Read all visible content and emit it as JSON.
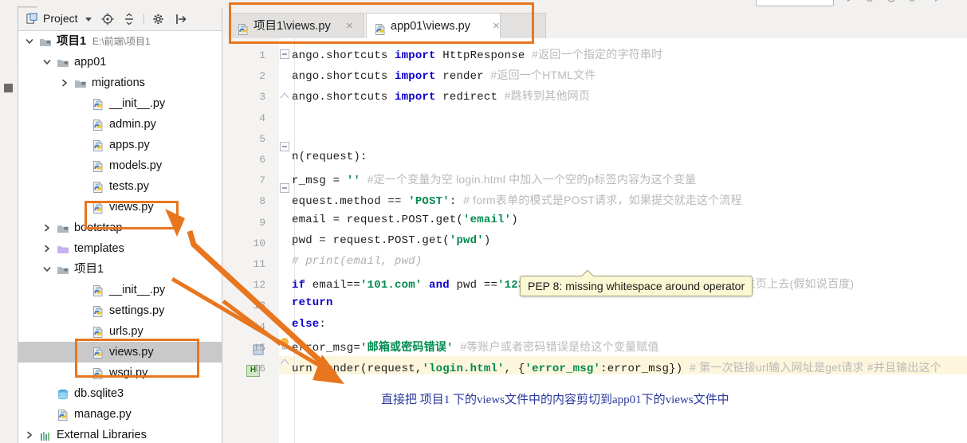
{
  "window": {
    "left_tool_tab": "1: Project"
  },
  "project_panel": {
    "title": "Project",
    "icons": [
      "project-view-icon",
      "chevron-down-icon",
      "locate-icon",
      "collapse-all-icon",
      "gear-icon",
      "hide-panel-icon"
    ],
    "tree": [
      {
        "depth": 0,
        "arrow": "down",
        "icon": "folder-icon",
        "label": "项目1",
        "sub": "E:\\前端\\项目1",
        "bold": true,
        "selected": false
      },
      {
        "depth": 1,
        "arrow": "down",
        "icon": "module-icon",
        "label": "app01",
        "sub": "",
        "bold": false,
        "selected": false
      },
      {
        "depth": 2,
        "arrow": "right",
        "icon": "module-icon",
        "label": "migrations",
        "sub": "",
        "bold": false,
        "selected": false
      },
      {
        "depth": 3,
        "arrow": "none",
        "icon": "python-icon",
        "label": "__init__.py",
        "sub": "",
        "bold": false,
        "selected": false
      },
      {
        "depth": 3,
        "arrow": "none",
        "icon": "python-icon",
        "label": "admin.py",
        "sub": "",
        "bold": false,
        "selected": false
      },
      {
        "depth": 3,
        "arrow": "none",
        "icon": "python-icon",
        "label": "apps.py",
        "sub": "",
        "bold": false,
        "selected": false
      },
      {
        "depth": 3,
        "arrow": "none",
        "icon": "python-icon",
        "label": "models.py",
        "sub": "",
        "bold": false,
        "selected": false
      },
      {
        "depth": 3,
        "arrow": "none",
        "icon": "python-icon",
        "label": "tests.py",
        "sub": "",
        "bold": false,
        "selected": false
      },
      {
        "depth": 3,
        "arrow": "none",
        "icon": "python-icon",
        "label": "views.py",
        "sub": "",
        "bold": false,
        "selected": false
      },
      {
        "depth": 1,
        "arrow": "right",
        "icon": "module-icon",
        "label": "bootstrap",
        "sub": "",
        "bold": false,
        "selected": false
      },
      {
        "depth": 1,
        "arrow": "right",
        "icon": "tpl-folder-icon",
        "label": "templates",
        "sub": "",
        "bold": false,
        "selected": false
      },
      {
        "depth": 1,
        "arrow": "down",
        "icon": "module-icon",
        "label": "项目1",
        "sub": "",
        "bold": false,
        "selected": false
      },
      {
        "depth": 3,
        "arrow": "none",
        "icon": "python-icon",
        "label": "__init__.py",
        "sub": "",
        "bold": false,
        "selected": false
      },
      {
        "depth": 3,
        "arrow": "none",
        "icon": "python-icon",
        "label": "settings.py",
        "sub": "",
        "bold": false,
        "selected": false
      },
      {
        "depth": 3,
        "arrow": "none",
        "icon": "python-icon",
        "label": "urls.py",
        "sub": "",
        "bold": false,
        "selected": false
      },
      {
        "depth": 3,
        "arrow": "none",
        "icon": "python-icon",
        "label": "views.py",
        "sub": "",
        "bold": false,
        "selected": true
      },
      {
        "depth": 3,
        "arrow": "none",
        "icon": "python-icon",
        "label": "wsgi.py",
        "sub": "",
        "bold": false,
        "selected": false
      },
      {
        "depth": 1,
        "arrow": "none",
        "icon": "db-icon",
        "label": "db.sqlite3",
        "sub": "",
        "bold": false,
        "selected": false
      },
      {
        "depth": 1,
        "arrow": "none",
        "icon": "python-icon",
        "label": "manage.py",
        "sub": "",
        "bold": false,
        "selected": false
      },
      {
        "depth": 0,
        "arrow": "right",
        "icon": "library-icon",
        "label": "External Libraries",
        "sub": "",
        "bold": false,
        "selected": false
      }
    ]
  },
  "editor": {
    "tabs": [
      {
        "label": "项目1\\views.py",
        "icon": "python-file-icon",
        "active": false,
        "close": "×"
      },
      {
        "label": "app01\\views.py",
        "icon": "python-file-icon",
        "active": true,
        "close": "×"
      }
    ],
    "gutter_numbers": [
      "1",
      "2",
      "3",
      "4",
      "5",
      "6",
      "7",
      "8",
      "9",
      "10",
      "11",
      "12",
      "13",
      "14",
      "15",
      "16"
    ],
    "h_marker_label": "H",
    "lines": [
      {
        "n": "1",
        "segments": [
          {
            "t": "ango.shortcuts ",
            "c": "plain"
          },
          {
            "t": "import",
            "c": "kw"
          },
          {
            "t": " HttpResponse   ",
            "c": "plain"
          },
          {
            "t": "#返回一个指定的字符串时",
            "c": "cmt-cjk"
          }
        ]
      },
      {
        "n": "2",
        "segments": [
          {
            "t": "ango.shortcuts ",
            "c": "plain"
          },
          {
            "t": "import",
            "c": "kw"
          },
          {
            "t": " render     ",
            "c": "plain"
          },
          {
            "t": "#返回一个HTML文件",
            "c": "cmt-cjk"
          }
        ]
      },
      {
        "n": "3",
        "segments": [
          {
            "t": "ango.shortcuts ",
            "c": "plain"
          },
          {
            "t": "import",
            "c": "kw"
          },
          {
            "t": " redirect   ",
            "c": "plain"
          },
          {
            "t": "#跳转到其他网页",
            "c": "cmt-cjk"
          }
        ]
      },
      {
        "n": "4",
        "segments": []
      },
      {
        "n": "5",
        "segments": []
      },
      {
        "n": "6",
        "segments": [
          {
            "t": "n(request):",
            "c": "plain"
          }
        ]
      },
      {
        "n": "7",
        "segments": [
          {
            "t": "r_msg = ",
            "c": "plain"
          },
          {
            "t": "''",
            "c": "str"
          },
          {
            "t": "      ",
            "c": "plain"
          },
          {
            "t": "#定一个变量为空   login.html 中加入一个空的p标签内容为这个变量",
            "c": "cmt-cjk"
          }
        ]
      },
      {
        "n": "8",
        "segments": [
          {
            "t": "equest.method == ",
            "c": "plain"
          },
          {
            "t": "'POST'",
            "c": "str"
          },
          {
            "t": ":        ",
            "c": "plain"
          },
          {
            "t": "# form表单的模式是POST请求，如果提交就走这个流程",
            "c": "cmt-cjk"
          }
        ]
      },
      {
        "n": "9",
        "segments": [
          {
            "t": "email = request.POST.get(",
            "c": "plain"
          },
          {
            "t": "'email'",
            "c": "str"
          },
          {
            "t": ")",
            "c": "plain"
          }
        ]
      },
      {
        "n": "10",
        "segments": [
          {
            "t": "pwd = request.POST.get(",
            "c": "plain"
          },
          {
            "t": "'pwd'",
            "c": "str"
          },
          {
            "t": ")",
            "c": "plain"
          }
        ]
      },
      {
        "n": "11",
        "segments": [
          {
            "t": "# print(email, pwd)",
            "c": "cmt"
          }
        ]
      },
      {
        "n": "12",
        "segments": [
          {
            "t": "if",
            "c": "kw"
          },
          {
            "t": " email==",
            "c": "plain"
          },
          {
            "t": "'101.com'",
            "c": "str"
          },
          {
            "t": " ",
            "c": "plain"
          },
          {
            "t": "and",
            "c": "kw"
          },
          {
            "t": " pwd ==",
            "c": "plain"
          },
          {
            "t": "'123'",
            "c": "str"
          },
          {
            "t": ":   ",
            "c": "plain"
          },
          {
            "t": "#假设账户和密码是正确的，需要跳转到主页上去(假如说百度)",
            "c": "cmt-cjk"
          }
        ]
      },
      {
        "n": "13",
        "segments": [
          {
            "t": "    ",
            "c": "plain"
          },
          {
            "t": "return",
            "c": "kw"
          },
          {
            "t": " ",
            "c": "plain"
          }
        ]
      },
      {
        "n": "14",
        "segments": [
          {
            "t": "else",
            "c": "kw"
          },
          {
            "t": ":",
            "c": "plain"
          }
        ]
      },
      {
        "n": "15",
        "segments": [
          {
            "t": "    error_msg=",
            "c": "plain"
          },
          {
            "t": "'邮箱或密码错误'",
            "c": "str"
          },
          {
            "t": "      ",
            "c": "plain"
          },
          {
            "t": "#等账户或者密码错误是给这个变量赋值",
            "c": "cmt-cjk"
          }
        ]
      },
      {
        "n": "16",
        "segments": [
          {
            "t": "urn render(request,",
            "c": "plain"
          },
          {
            "t": "'login.html'",
            "c": "str"
          },
          {
            "t": ", {",
            "c": "plain"
          },
          {
            "t": "'error_msg'",
            "c": "str"
          },
          {
            "t": ":error_msg})    ",
            "c": "plain"
          },
          {
            "t": "# 第一次链接url输入网址是get请求    #并且输出这个",
            "c": "cmt-cjk"
          }
        ]
      }
    ],
    "tooltip": "PEP 8: missing whitespace around operator"
  },
  "annotations": {
    "note": "直接把 项目1 下的views文件中的内容剪切到app01下的views文件中",
    "accent_color": "#e8761e",
    "note_color": "#2b3a9e",
    "boxes": [
      "tabs-highlight-box",
      "app01-views-highlight-box",
      "project1-views-highlight-box"
    ],
    "arrows": [
      "arrow-up-to-app01-views",
      "arrow-down-to-note"
    ]
  }
}
